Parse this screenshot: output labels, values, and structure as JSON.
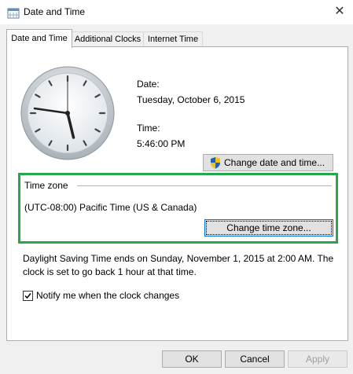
{
  "window": {
    "title": "Date and Time",
    "close_glyph": "✕"
  },
  "tabs": [
    {
      "label": "Date and Time",
      "active": true
    },
    {
      "label": "Additional Clocks",
      "active": false
    },
    {
      "label": "Internet Time",
      "active": false
    }
  ],
  "date": {
    "label": "Date:",
    "value": "Tuesday, October 6, 2015"
  },
  "time": {
    "label": "Time:",
    "value": "5:46:00 PM"
  },
  "change_date_button": {
    "label": "Change date and time...",
    "icon": "uac-shield-icon"
  },
  "time_zone": {
    "section_label": "Time zone",
    "value": "(UTC-08:00) Pacific Time (US & Canada)",
    "button_label": "Change time zone...",
    "highlight_color": "#24a84a"
  },
  "dst_notice": {
    "line1": "Daylight Saving Time ends on Sunday, November 1, 2015 at 2:00 AM. The",
    "line2": "clock is set to go back 1 hour at that time."
  },
  "notify_checkbox": {
    "label": "Notify me when the clock changes",
    "checked": true
  },
  "dialog_buttons": {
    "ok": "OK",
    "cancel": "Cancel",
    "apply": "Apply"
  }
}
